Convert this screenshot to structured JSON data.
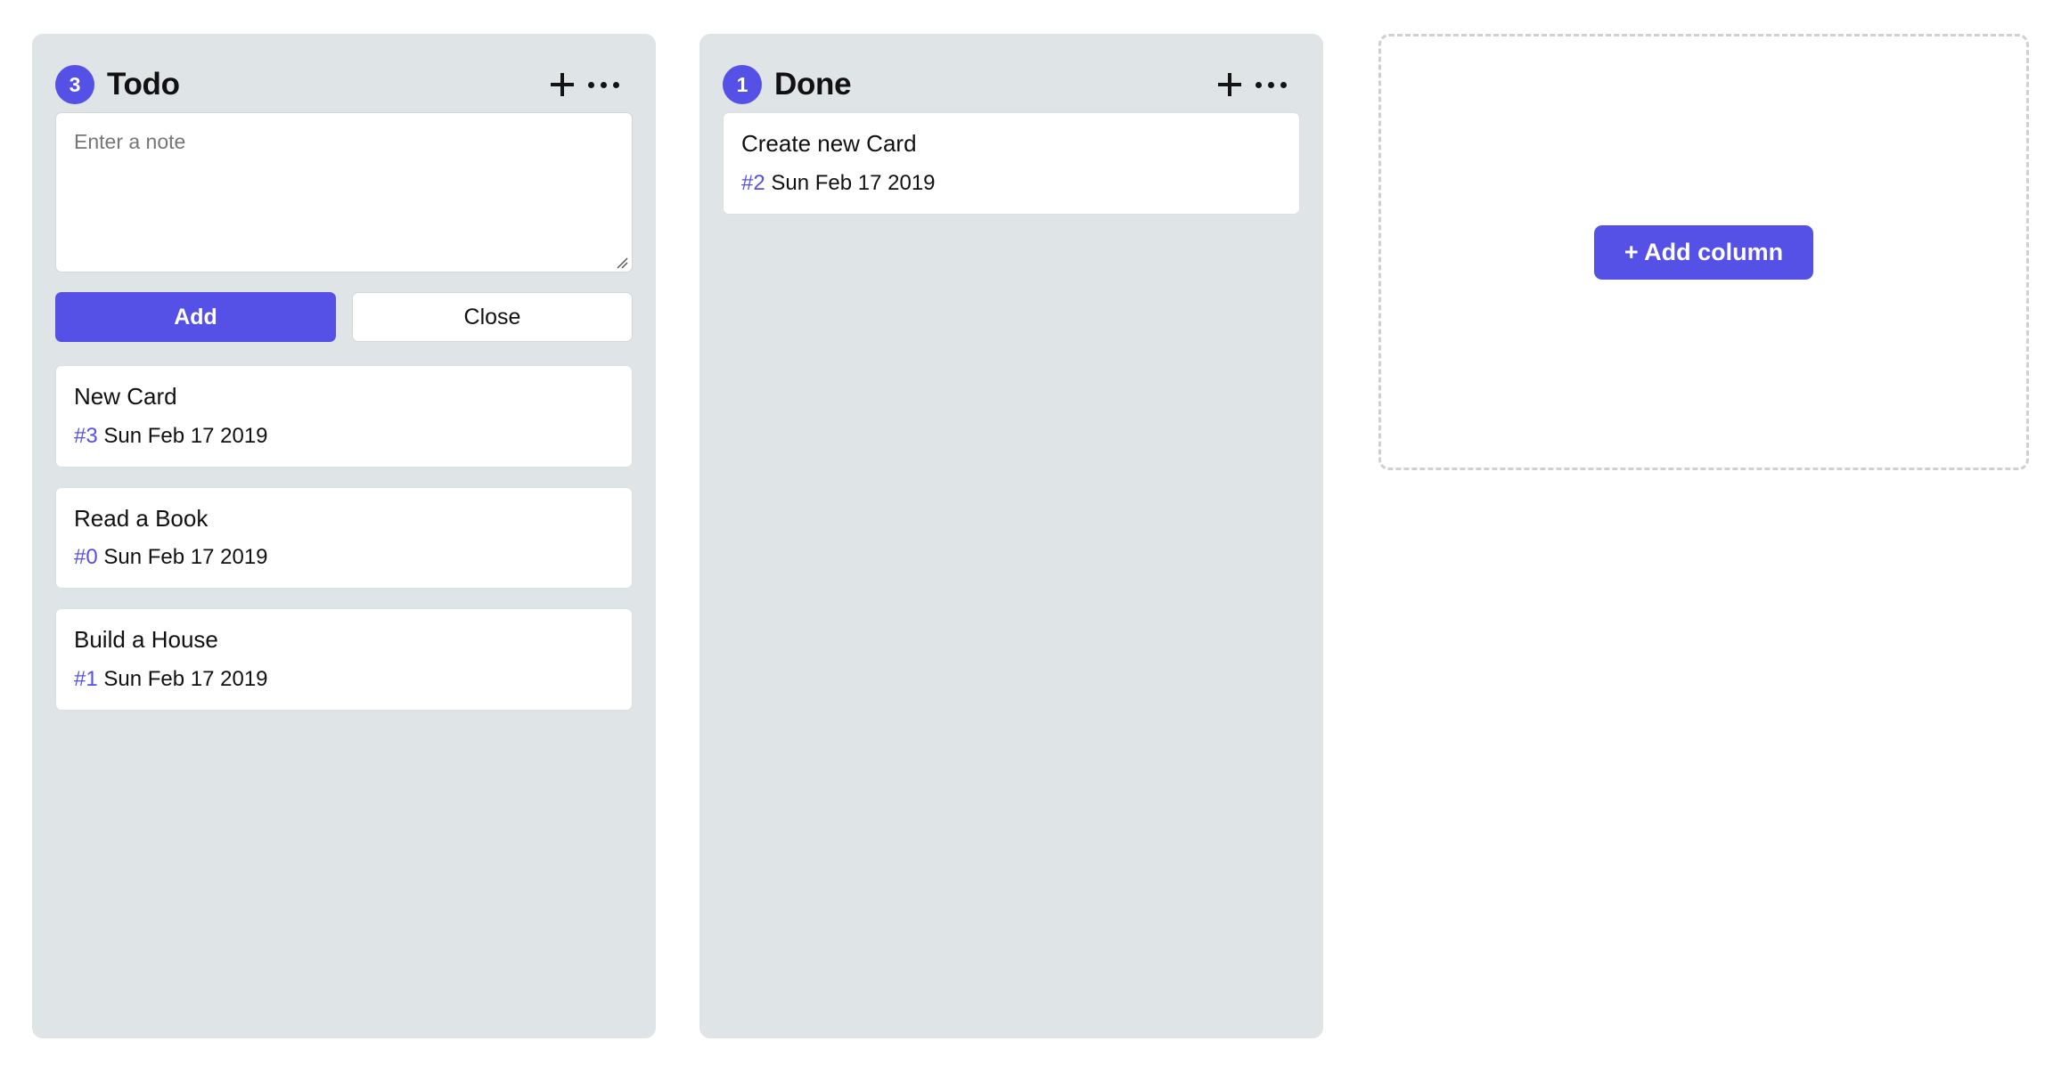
{
  "board": {
    "columns": [
      {
        "id": "todo",
        "title": "Todo",
        "count": "3",
        "add_icon": "plus-icon",
        "menu_icon": "ellipsis-icon",
        "composer": {
          "visible": true,
          "value": "",
          "placeholder": "Enter a note",
          "add_label": "Add",
          "close_label": "Close"
        },
        "cards": [
          {
            "title": "New Card",
            "id_label": "#3",
            "date": "Sun Feb 17 2019"
          },
          {
            "title": "Read a Book",
            "id_label": "#0",
            "date": "Sun Feb 17 2019"
          },
          {
            "title": "Build a House",
            "id_label": "#1",
            "date": "Sun Feb 17 2019"
          }
        ]
      },
      {
        "id": "done",
        "title": "Done",
        "count": "1",
        "add_icon": "plus-icon",
        "menu_icon": "ellipsis-icon",
        "composer": {
          "visible": false
        },
        "cards": [
          {
            "title": "Create new Card",
            "id_label": "#2",
            "date": "Sun Feb 17 2019"
          }
        ]
      }
    ],
    "add_column": {
      "label": "+ Add column"
    }
  },
  "colors": {
    "accent": "#5550e6",
    "column_bg": "#dfe4e7",
    "card_bg": "#ffffff",
    "card_border": "#dcdfe2",
    "page_bg": "#ffffff",
    "dashed_border": "#d0d0d0",
    "placeholder_text": "#767676"
  }
}
